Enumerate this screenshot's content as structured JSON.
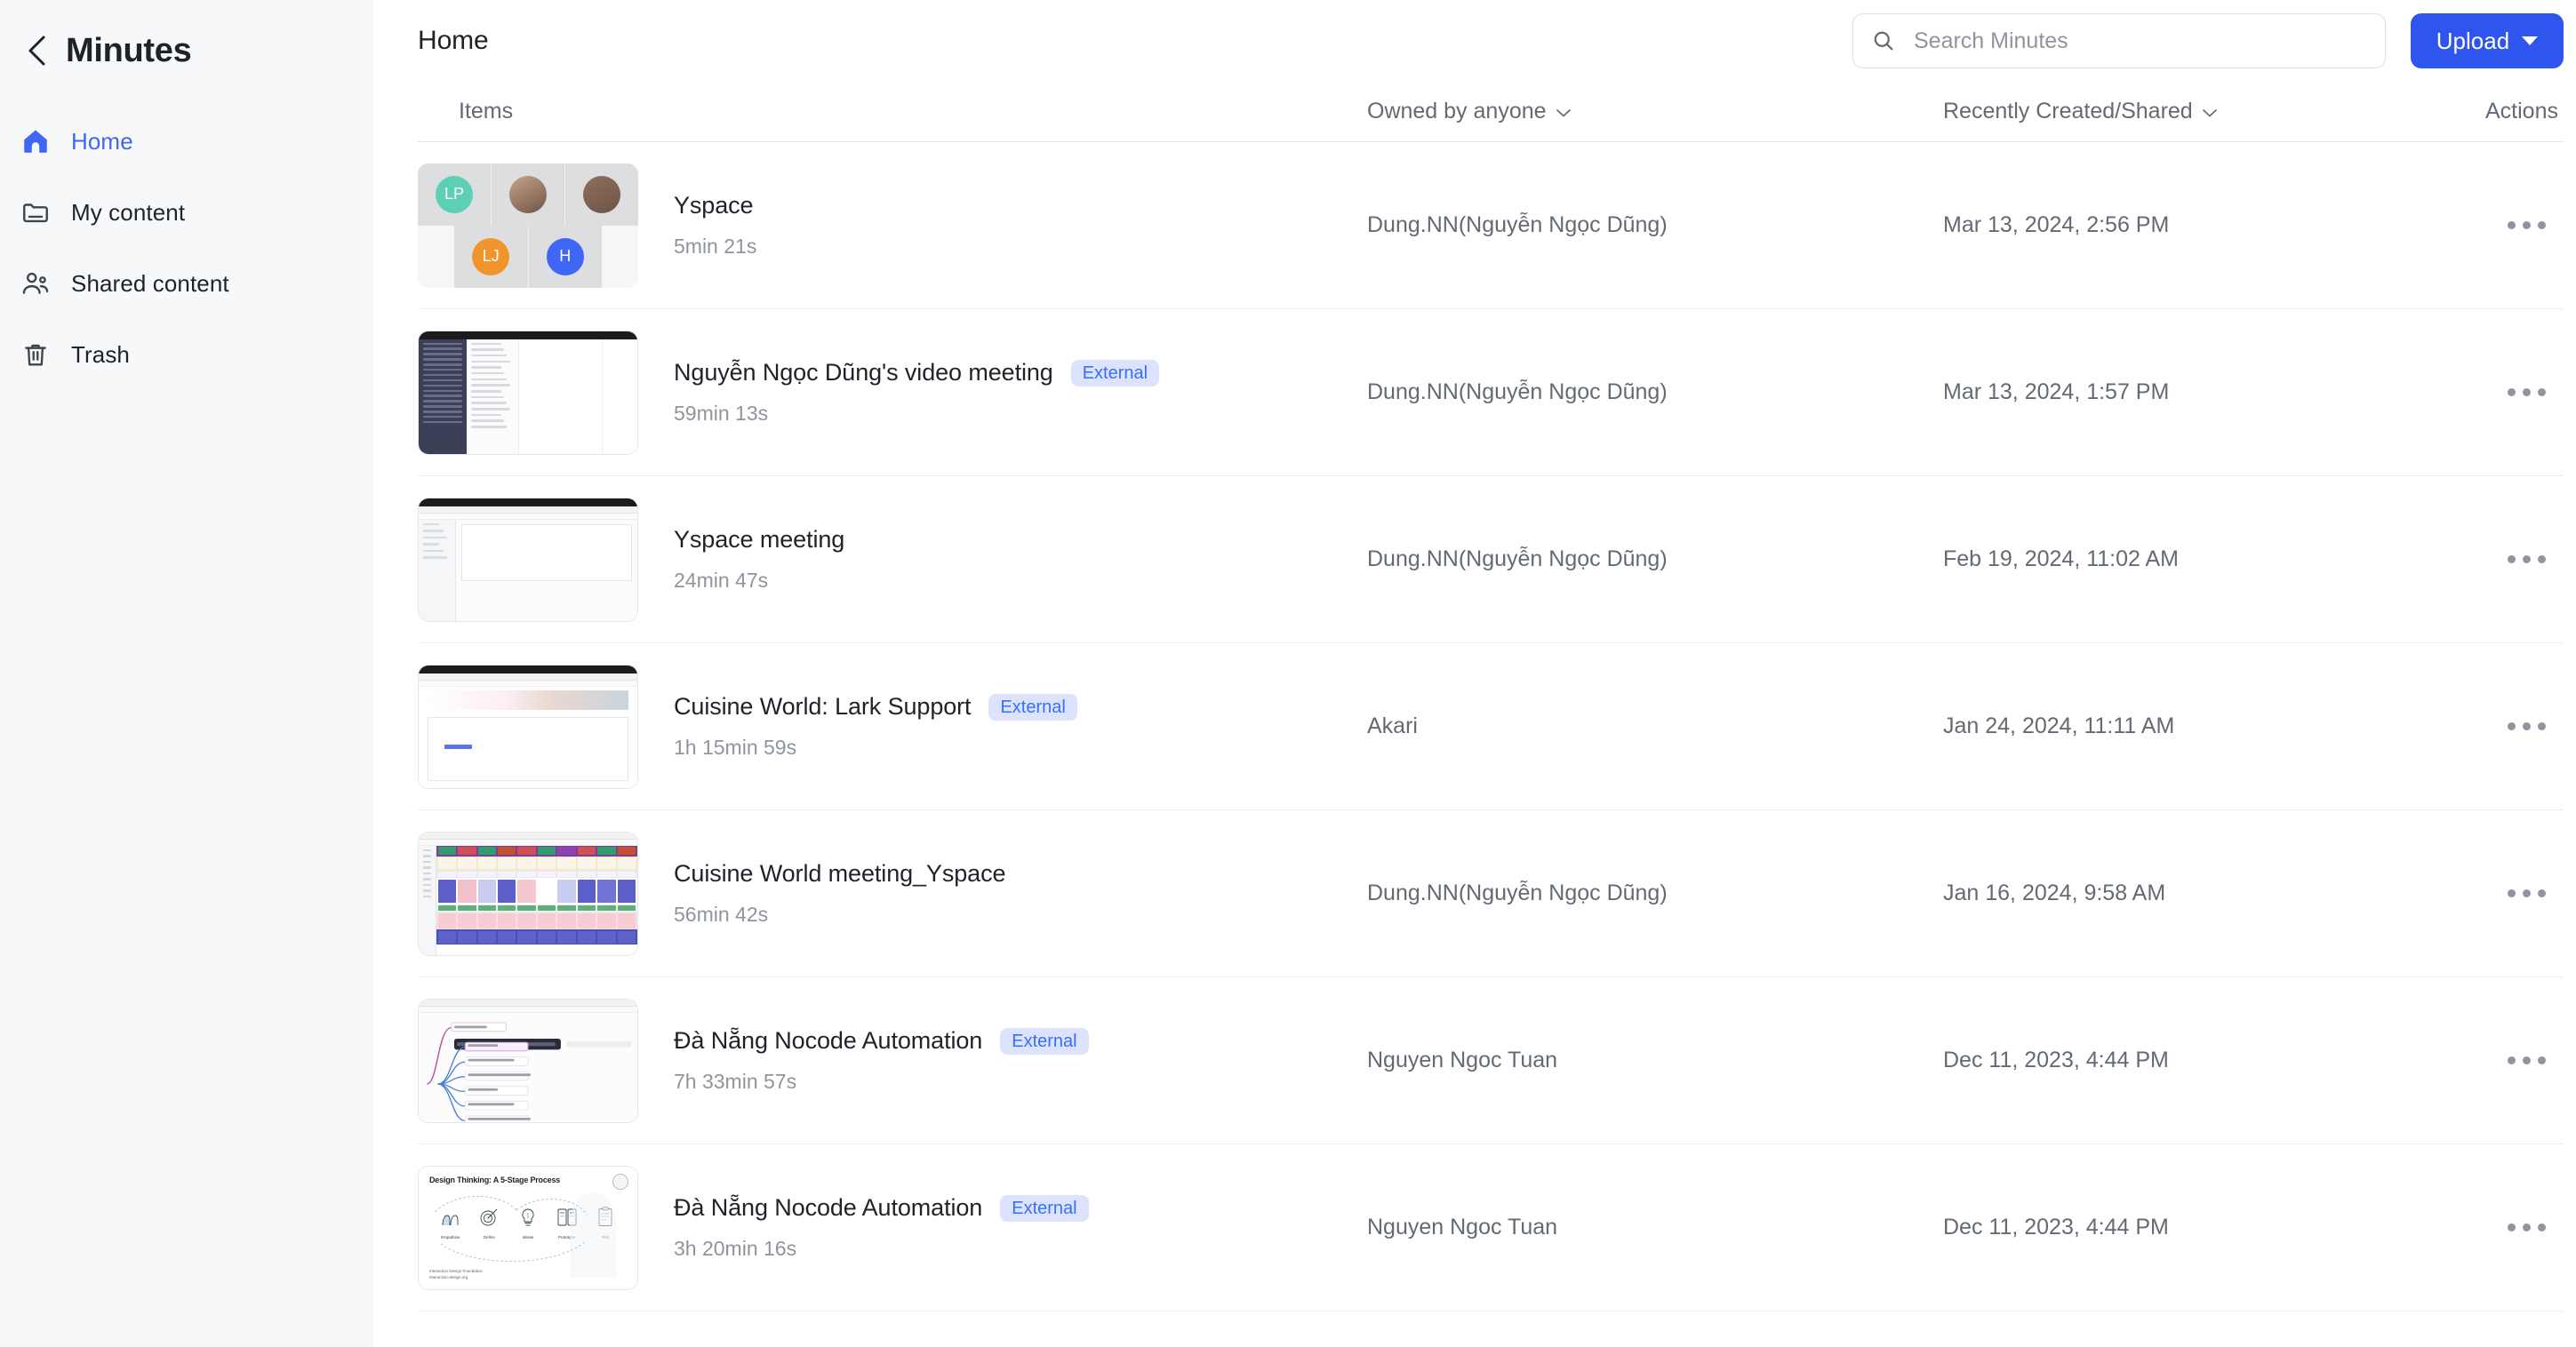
{
  "sidebar": {
    "title": "Minutes",
    "back_icon": "chevron-left-icon",
    "items": [
      {
        "label": "Home",
        "icon": "home-icon",
        "active": true
      },
      {
        "label": "My content",
        "icon": "folder-icon",
        "active": false
      },
      {
        "label": "Shared content",
        "icon": "people-icon",
        "active": false
      },
      {
        "label": "Trash",
        "icon": "trash-icon",
        "active": false
      }
    ]
  },
  "header": {
    "page_title": "Home",
    "search": {
      "placeholder": "Search Minutes",
      "value": "",
      "icon": "search-icon"
    },
    "upload": {
      "label": "Upload",
      "icon": "chevron-down-icon"
    }
  },
  "table": {
    "columns": {
      "items": "Items",
      "owner": "Owned by anyone",
      "date": "Recently Created/Shared",
      "actions": "Actions"
    },
    "owner_sort_icon": "chevron-down-icon",
    "date_sort_icon": "chevron-down-icon",
    "actions_icon": "more-horizontal-icon",
    "rows": [
      {
        "title": "Yspace",
        "badge": "",
        "duration": "5min 21s",
        "owner": "Dung.NN(Nguyễn Ngọc Dũng)",
        "date": "Mar 13, 2024, 2:56 PM",
        "thumb_type": "avatars",
        "avatars": [
          {
            "initials": "LP",
            "color": "#5ccfb4",
            "photo": false
          },
          {
            "initials": "",
            "color": "#c8a48a",
            "photo": true
          },
          {
            "initials": "",
            "color": "#8e6f5d",
            "photo": true
          },
          {
            "initials": "LJ",
            "color": "#f0952b",
            "photo": false
          },
          {
            "initials": "H",
            "color": "#3f66f5",
            "photo": false
          }
        ]
      },
      {
        "title": "Nguyễn Ngọc Dũng's video meeting",
        "badge": "External",
        "duration": "59min 13s",
        "owner": "Dung.NN(Nguyễn Ngọc Dũng)",
        "date": "Mar 13, 2024, 1:57 PM",
        "thumb_type": "chat-app"
      },
      {
        "title": "Yspace meeting",
        "badge": "",
        "duration": "24min 47s",
        "owner": "Dung.NN(Nguyễn Ngọc Dũng)",
        "date": "Feb 19, 2024, 11:02 AM",
        "thumb_type": "table-app"
      },
      {
        "title": "Cuisine World: Lark Support",
        "badge": "External",
        "duration": "1h 15min 59s",
        "owner": "Akari",
        "date": "Jan 24, 2024, 11:11 AM",
        "thumb_type": "doc-app"
      },
      {
        "title": "Cuisine World meeting_Yspace",
        "badge": "",
        "duration": "56min 42s",
        "owner": "Dung.NN(Nguyễn Ngọc Dũng)",
        "date": "Jan 16, 2024, 9:58 AM",
        "thumb_type": "sheet-app"
      },
      {
        "title": "Đà Nẵng Nocode Automation",
        "badge": "External",
        "duration": "7h 33min 57s",
        "owner": "Nguyen Ngoc Tuan",
        "date": "Dec 11, 2023, 4:44 PM",
        "thumb_type": "mindmap"
      },
      {
        "title": "Đà Nẵng Nocode Automation",
        "badge": "External",
        "duration": "3h 20min 16s",
        "owner": "Nguyen Ngoc Tuan",
        "date": "Dec 11, 2023, 4:44 PM",
        "thumb_type": "design-thinking",
        "thumb_text": {
          "title": "Design Thinking: A 5-Stage Process",
          "stages": [
            "Empathise",
            "Define",
            "Ideate",
            "Prototype",
            "Test"
          ],
          "footer_line1": "Interaction Design Foundation",
          "footer_line2": "interaction-design.org"
        }
      }
    ]
  },
  "colors": {
    "accent": "#3f66f5",
    "upload_bg": "#2f55ef",
    "badge_bg": "#dee3fd",
    "badge_fg": "#3370ff",
    "sidebar_bg": "#f7f8fa",
    "text_primary": "#1f2329",
    "text_secondary": "#646a73",
    "text_muted": "#8f959e"
  }
}
